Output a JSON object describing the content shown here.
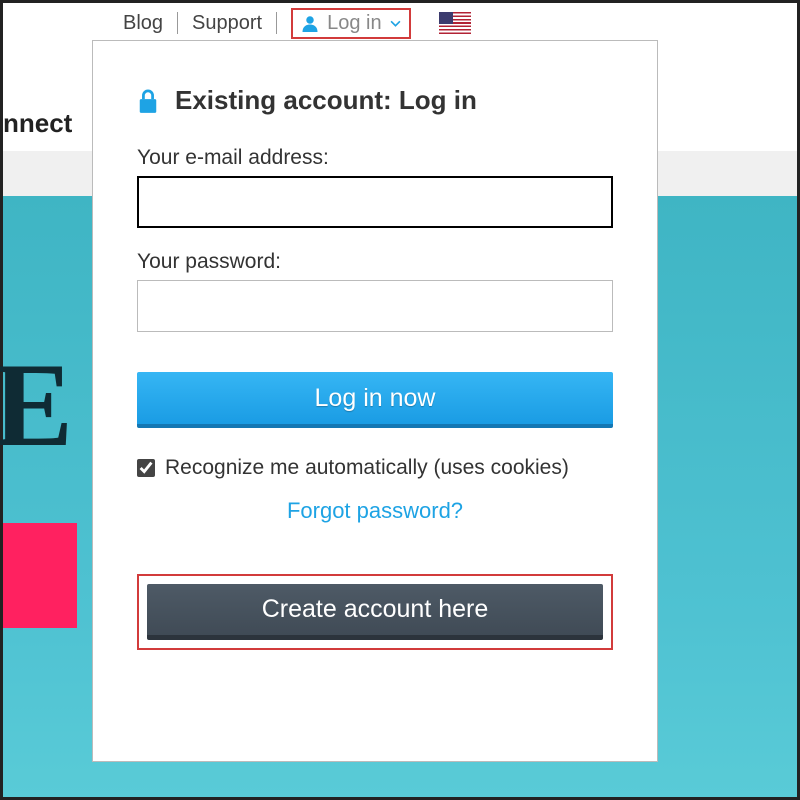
{
  "topbar": {
    "blog": "Blog",
    "support": "Support",
    "login_trigger": "Log in"
  },
  "brand_partial": "nnect",
  "hero_text": "E",
  "login": {
    "title": "Existing account: Log in",
    "email_label": "Your e-mail address:",
    "password_label": "Your password:",
    "submit": "Log in now",
    "remember": "Recognize me automatically (uses cookies)",
    "forgot": "Forgot password?",
    "create": "Create account here"
  }
}
